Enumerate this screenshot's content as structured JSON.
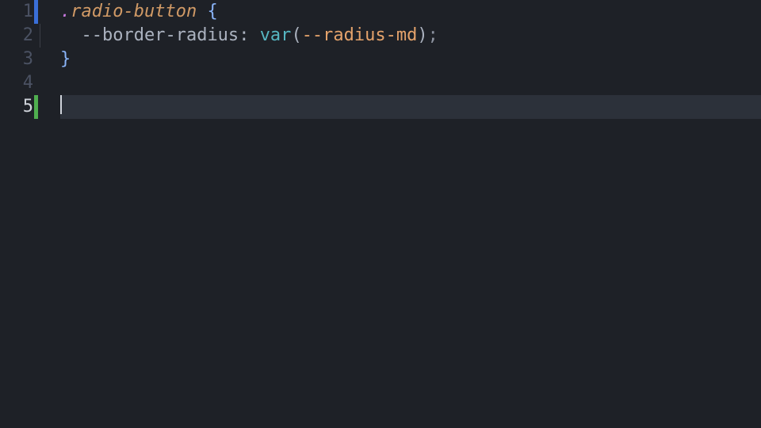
{
  "gutter": {
    "lines": [
      "1",
      "2",
      "3",
      "4",
      "5"
    ],
    "current_index": 4,
    "marks": [
      "changed",
      "",
      "",
      "",
      "added"
    ]
  },
  "code": {
    "l1": {
      "dot": ".",
      "selector": "radio-button",
      "sp": " ",
      "brace_open": "{"
    },
    "l2": {
      "indent": "  ",
      "prop": "--border-radius",
      "colon": ": ",
      "func": "var",
      "paren_open": "(",
      "arg": "--radius-md",
      "paren_close": ")",
      "semi": ";"
    },
    "l3": {
      "brace_close": "}"
    },
    "l4": {
      "blank": ""
    },
    "l5": {
      "blank": ""
    }
  }
}
